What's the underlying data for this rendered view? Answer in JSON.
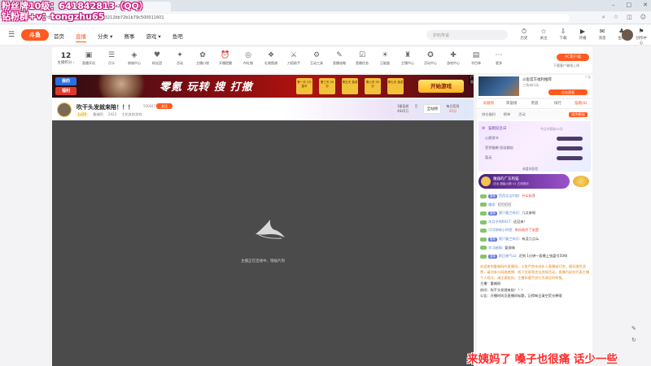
{
  "browser": {
    "tab_title": "159?dyshid=3b18a2e",
    "url": "159?dyshid=3b18a2e-dacefcd633212bb72b1b79c500011601",
    "window_controls": [
      "–",
      "□",
      "✕"
    ]
  },
  "header": {
    "logo": "斗鱼",
    "nav": [
      "首页",
      "直播",
      "分类 ▾",
      "赛事",
      "游戏 ▾",
      "鱼吧"
    ],
    "active_nav": "直播",
    "search_placeholder": "护石传说",
    "tools": [
      {
        "icon": "⏱",
        "label": "历史"
      },
      {
        "icon": "☆",
        "label": "关注"
      },
      {
        "icon": "⇩",
        "label": "下载"
      },
      {
        "icon": "▶",
        "label": "开播"
      },
      {
        "icon": "✉",
        "label": "消息"
      },
      {
        "icon": "♣",
        "label": "鱼吧"
      },
      {
        "icon": "⚑",
        "label": "创作中心"
      },
      {
        "icon": "♛",
        "label": "任务"
      }
    ]
  },
  "shortcut": {
    "level_num": "12",
    "level_label": "主播积分 ›",
    "items": [
      "直播开机",
      "月卡",
      "商城中心",
      "粉丝团",
      "活动",
      "主播口袋",
      "开播提醒",
      "AI礼物",
      "礼物图谱",
      "刀塔助手",
      "互动工具",
      "直播攻略",
      "直播任务",
      "正能量",
      "主播中心",
      "活动中心",
      "游戏中心",
      "节目单",
      "更多"
    ],
    "icons": [
      "▣",
      "☰",
      "◈",
      "♥",
      "✦",
      "✿",
      "⏰",
      "◎",
      "❖",
      "⚔",
      "⚙",
      "✎",
      "☑",
      "☀",
      "♜",
      "✪",
      "✚",
      "▤",
      "⋯"
    ],
    "pc_badge": "PC客户端",
    "pc_sub": "下载客户端领上线"
  },
  "banner": {
    "pill1": "我的",
    "pill2": "福利",
    "title": "零氪 玩转 搜 打撤",
    "chips": [
      "第一天 2分皇币",
      "第三天 20分",
      "第五天 抽奖",
      "第六天 20分",
      "第七天 抽奖"
    ],
    "start": "开始游戏",
    "ad": "广告"
  },
  "right_ad": {
    "title": "斗鱼官方福利推荐",
    "sub": "三角洲行动",
    "btn": "点击观看",
    "ad": "广告"
  },
  "room": {
    "title": "吹干头发就来陪！！！",
    "id": "500047",
    "follow": "关注",
    "meta": [
      "Lv20",
      "重端网",
      "2422",
      "主机其他游戏"
    ],
    "stats": [
      "3星画质",
      "分享",
      "全站榜",
      "每日签到"
    ],
    "stat_values": [
      "4645万",
      "",
      "",
      "20分"
    ]
  },
  "player": {
    "loading_text": "主播正在连线中，稍候片刻"
  },
  "chat_tabs": [
    "贡献榜",
    "荣誉榜",
    "贵族",
    "排行",
    "猫粮(8)"
  ],
  "chat_sub": [
    "排位福利",
    "榜单",
    "活动",
    "成为粉丝"
  ],
  "card": {
    "title": "猫粮纪念日",
    "note": "今日共获取30次",
    "rows": [
      "心愿保节",
      "签到猫粮·双倍翻倍",
      "暂无"
    ],
    "foot": "恭喜你获得"
  },
  "gift_banner": {
    "name": "魔器的广东和猫",
    "sub": "送出 超级火箭 x1 占领首页"
  },
  "messages": [
    {
      "name": "西西吉吉利娃:",
      "text": "什么标签",
      "badge": "皇帝",
      "red": true
    },
    {
      "name": "儒家:",
      "text": "打打打打",
      "badge": "",
      "red": false
    },
    {
      "name": "我只看兰林贝:",
      "text": "几点来呀",
      "badge": "皇帝",
      "red": false
    },
    {
      "name": "木月子明0927:",
      "text": "还没来！",
      "badge": "",
      "red": false
    },
    {
      "name": "可可咖啡小四宫:",
      "text": "吹风机坏了说是",
      "badge": "",
      "red": true
    },
    {
      "name": "我只看兰林贝:",
      "text": "有没几点么",
      "badge": "皇帝",
      "red": false
    },
    {
      "name": "学习越搞:",
      "text": "爱丽嗨",
      "badge": "",
      "red": false
    },
    {
      "name": "斯日香气xz:",
      "text": "迟到 1分钟一段晚上钱盘号50W",
      "badge": "皇帝",
      "red": false
    }
  ],
  "system_msg": "欢迎来到重端网的直播间。斗鱼严禁未成年人直播或打赏，倡导理性消费，请勿参与网络赌博、线下交易等违法违规活动。直播内容仅代表主播个人观点，请注意甄别。主播如遇不良行为请及时举报。",
  "info": {
    "anchor_label": "主播：",
    "anchor": "重端网",
    "room_label": "房间：",
    "room": "吹干头发就来陪！！！",
    "notice_label": "公告：",
    "notice": "开播时间见直播间标题，记得每日清空荧光棒哦"
  },
  "overlays": {
    "top_line1": "粉丝牌10级：641842813（QQ）",
    "top_line2": "钻粉群+v：tongzhu65",
    "bottom": "来姨妈了 嗓子也很痛 话少一些"
  }
}
